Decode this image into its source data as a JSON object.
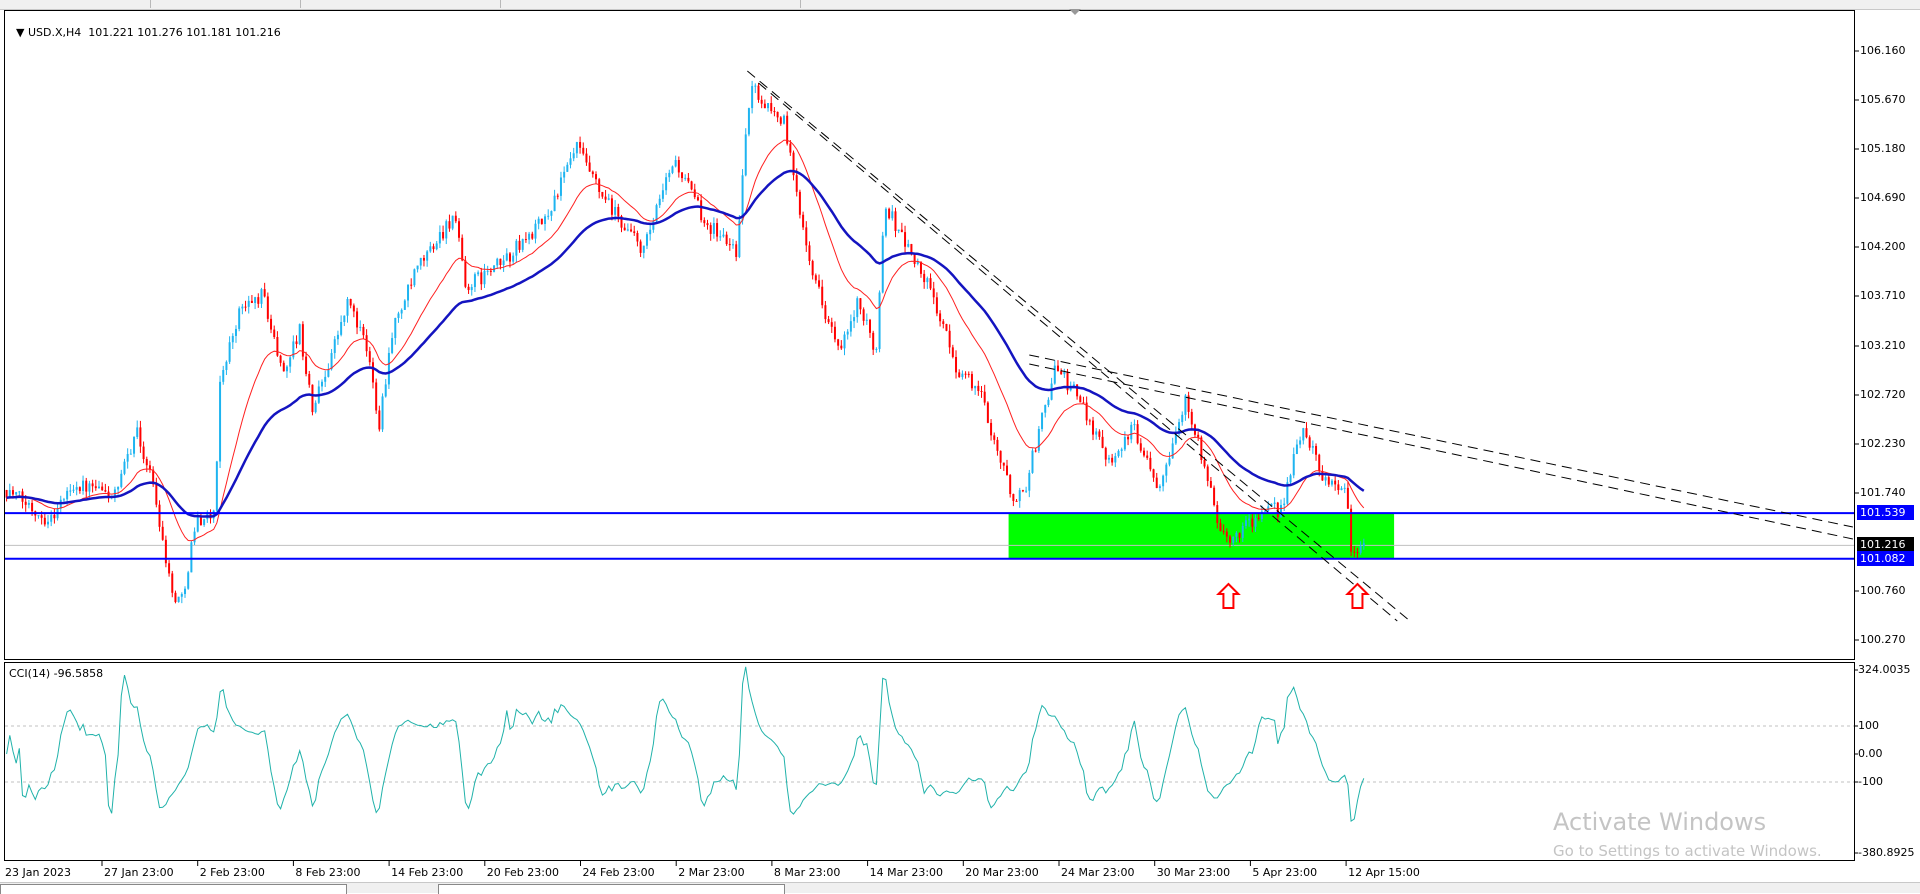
{
  "header": {
    "symbol_legend": "USD.X,H4  101.221 101.276 101.181 101.216"
  },
  "cci": {
    "legend": "CCI(14) -96.5858",
    "levels": [
      "324.0035",
      "100",
      "0.00",
      "-100",
      "-380.8925"
    ]
  },
  "price_axis": [
    "106.160",
    "105.670",
    "105.180",
    "104.690",
    "104.200",
    "103.710",
    "103.210",
    "102.720",
    "102.230",
    "101.740",
    "100.760",
    "100.270"
  ],
  "tags": {
    "resistance": "101.539",
    "current": "101.216",
    "support": "101.082"
  },
  "time_axis": [
    "23 Jan 2023",
    "27 Jan 23:00",
    "2 Feb 23:00",
    "8 Feb 23:00",
    "14 Feb 23:00",
    "20 Feb 23:00",
    "24 Feb 23:00",
    "2 Mar 23:00",
    "8 Mar 23:00",
    "14 Mar 23:00",
    "20 Mar 23:00",
    "24 Mar 23:00",
    "30 Mar 23:00",
    "5 Apr 23:00",
    "12 Apr 15:00"
  ],
  "watermark": {
    "title": "Activate Windows",
    "subtitle": "Go to Settings to activate Windows."
  },
  "colors": {
    "bull": "#1eb4f0",
    "bear": "#ff0000",
    "ma_fast": "#ff2020",
    "ma_slow": "#1414c0",
    "zone": "#00ff00",
    "hline": "#0000ff",
    "cci": "#20b2aa"
  },
  "chart_data": {
    "type": "candlestick",
    "symbol": "USD.X",
    "timeframe": "H4",
    "ylim": [
      100.0,
      106.4
    ],
    "close_path_days_price": [
      [
        0.1,
        101.77
      ],
      [
        2.8,
        101.47
      ],
      [
        4.3,
        101.83
      ],
      [
        7.0,
        101.71
      ],
      [
        8.2,
        102.38
      ],
      [
        9.3,
        101.83
      ],
      [
        10.5,
        100.73
      ],
      [
        11.1,
        100.67
      ],
      [
        12.0,
        101.47
      ],
      [
        13.2,
        101.53
      ],
      [
        13.5,
        102.87
      ],
      [
        14.7,
        103.55
      ],
      [
        16.2,
        103.73
      ],
      [
        17.4,
        102.94
      ],
      [
        18.5,
        103.36
      ],
      [
        19.3,
        102.57
      ],
      [
        21.6,
        103.67
      ],
      [
        22.8,
        103.12
      ],
      [
        23.5,
        102.45
      ],
      [
        24.3,
        103.36
      ],
      [
        25.9,
        103.98
      ],
      [
        28.2,
        104.53
      ],
      [
        28.9,
        103.79
      ],
      [
        31.2,
        104.04
      ],
      [
        33.9,
        104.47
      ],
      [
        35.9,
        105.2
      ],
      [
        37.4,
        104.71
      ],
      [
        40.1,
        104.16
      ],
      [
        42.0,
        105.08
      ],
      [
        43.9,
        104.47
      ],
      [
        45.9,
        104.16
      ],
      [
        46.8,
        105.81
      ],
      [
        47.8,
        105.63
      ],
      [
        48.9,
        105.45
      ],
      [
        49.7,
        104.71
      ],
      [
        50.9,
        103.85
      ],
      [
        52.4,
        103.12
      ],
      [
        53.5,
        103.61
      ],
      [
        54.7,
        103.18
      ],
      [
        55.2,
        104.65
      ],
      [
        56.6,
        104.22
      ],
      [
        58.2,
        103.73
      ],
      [
        59.7,
        103.0
      ],
      [
        61.2,
        102.75
      ],
      [
        63.2,
        101.71
      ],
      [
        63.9,
        101.71
      ],
      [
        65.9,
        103.0
      ],
      [
        67.4,
        102.69
      ],
      [
        69.3,
        102.08
      ],
      [
        70.9,
        102.38
      ],
      [
        72.4,
        101.83
      ],
      [
        74.2,
        102.69
      ],
      [
        75.5,
        101.83
      ],
      [
        76.6,
        101.22
      ],
      [
        78.2,
        101.47
      ],
      [
        80.1,
        101.59
      ],
      [
        81.5,
        102.41
      ],
      [
        82.8,
        101.89
      ],
      [
        84.2,
        101.77
      ],
      [
        84.5,
        101.16
      ],
      [
        85.4,
        101.22
      ]
    ],
    "last_bar": {
      "open": 101.221,
      "high": 101.276,
      "low": 101.181,
      "close": 101.216
    },
    "horizontal_lines": [
      101.539,
      101.082
    ],
    "current_price": 101.216,
    "zone": {
      "from_day": 63.0,
      "to_day": 87.2,
      "price_high": 101.539,
      "price_low": 101.082
    },
    "trendlines": [
      {
        "from": [
          46.6,
          105.96
        ],
        "to": [
          88.2,
          100.46
        ]
      },
      {
        "from": [
          47.3,
          105.84
        ],
        "to": [
          87.4,
          100.46
        ]
      },
      {
        "from": [
          64.3,
          103.12
        ],
        "to": [
          116.0,
          101.4
        ]
      },
      {
        "from": [
          64.3,
          103.03
        ],
        "to": [
          116.0,
          101.28
        ]
      }
    ],
    "arrows_up_days": [
      76.8,
      84.9
    ],
    "arrow_price": 100.71,
    "indicators": [
      "MA fast (red)",
      "MA slow (blue)",
      "CCI(14)"
    ],
    "cci_range": [
      -380.8925,
      324.0035
    ],
    "cci_levels": [
      100,
      -100
    ]
  }
}
